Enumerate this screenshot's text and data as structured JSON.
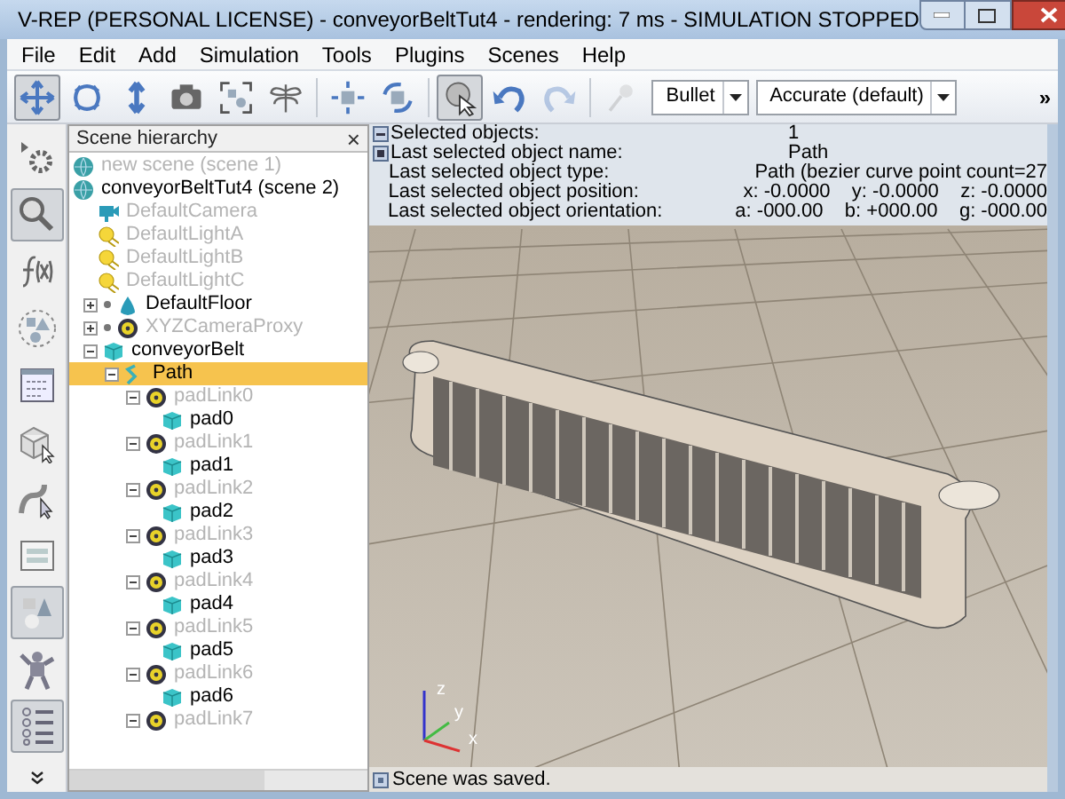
{
  "window": {
    "title": "V-REP (PERSONAL LICENSE) - conveyorBeltTut4 - rendering: 7 ms - SIMULATION STOPPED"
  },
  "menu": [
    "File",
    "Edit",
    "Add",
    "Simulation",
    "Tools",
    "Plugins",
    "Scenes",
    "Help"
  ],
  "toolbar": [
    {
      "kind": "move",
      "selected": true,
      "disabled": false
    },
    {
      "kind": "rotate",
      "selected": false,
      "disabled": false
    },
    {
      "kind": "zoom",
      "selected": false,
      "disabled": false
    },
    {
      "kind": "camera",
      "selected": false,
      "disabled": false
    },
    {
      "kind": "fit",
      "selected": false,
      "disabled": false
    },
    {
      "kind": "fly",
      "selected": false,
      "disabled": false
    },
    {
      "kind": "sep"
    },
    {
      "kind": "translate",
      "selected": false,
      "disabled": false
    },
    {
      "kind": "orient",
      "selected": false,
      "disabled": false
    },
    {
      "kind": "sep"
    },
    {
      "kind": "pointer",
      "selected": true,
      "disabled": false
    },
    {
      "kind": "undo",
      "selected": false,
      "disabled": false
    },
    {
      "kind": "redo",
      "selected": false,
      "disabled": true
    },
    {
      "kind": "sep"
    },
    {
      "kind": "pin",
      "selected": false,
      "disabled": true
    }
  ],
  "engine_dropdowns": [
    {
      "value": "Bullet"
    },
    {
      "value": "Accurate (default)"
    }
  ],
  "toolbar_overflow": "»",
  "side_toolbar": [
    {
      "kind": "properties",
      "selected": false
    },
    {
      "kind": "magnifier",
      "selected": true
    },
    {
      "kind": "script",
      "selected": false
    },
    {
      "kind": "shapes",
      "selected": false
    },
    {
      "kind": "dialog",
      "selected": false
    },
    {
      "kind": "cube",
      "selected": false
    },
    {
      "kind": "path",
      "selected": false
    },
    {
      "kind": "form",
      "selected": false
    },
    {
      "kind": "shapeedit",
      "selected": true
    },
    {
      "kind": "robot",
      "selected": false
    },
    {
      "kind": "list",
      "selected": true
    }
  ],
  "hierarchy": {
    "title": "Scene hierarchy",
    "close": "×",
    "items": [
      {
        "label": "new scene (scene 1)",
        "kind": "scene",
        "dimmed": true,
        "selected": false
      },
      {
        "label": "conveyorBeltTut4 (scene 2)",
        "kind": "scene",
        "dimmed": false,
        "selected": false,
        "children": [
          {
            "label": "DefaultCamera",
            "kind": "camera",
            "dimmed": true,
            "selected": false
          },
          {
            "label": "DefaultLightA",
            "kind": "light",
            "dimmed": true,
            "selected": false
          },
          {
            "label": "DefaultLightB",
            "kind": "light",
            "dimmed": true,
            "selected": false
          },
          {
            "label": "DefaultLightC",
            "kind": "light",
            "dimmed": true,
            "selected": false
          },
          {
            "label": "DefaultFloor",
            "kind": "floor",
            "dimmed": false,
            "selected": false,
            "expanded": false
          },
          {
            "label": "XYZCameraProxy",
            "kind": "dummy",
            "dimmed": true,
            "selected": false,
            "expanded": false
          },
          {
            "label": "conveyorBelt",
            "kind": "shape",
            "dimmed": false,
            "selected": false,
            "expanded": true,
            "children": [
              {
                "label": "Path",
                "kind": "path",
                "dimmed": false,
                "selected": true,
                "expanded": true,
                "children": [
                  {
                    "label": "padLink0",
                    "kind": "joint",
                    "dimmed": true,
                    "selected": false,
                    "expanded": true,
                    "children": [
                      {
                        "label": "pad0",
                        "kind": "shape",
                        "dimmed": false,
                        "selected": false
                      }
                    ]
                  },
                  {
                    "label": "padLink1",
                    "kind": "joint",
                    "dimmed": true,
                    "selected": false,
                    "expanded": true,
                    "children": [
                      {
                        "label": "pad1",
                        "kind": "shape",
                        "dimmed": false,
                        "selected": false
                      }
                    ]
                  },
                  {
                    "label": "padLink2",
                    "kind": "joint",
                    "dimmed": true,
                    "selected": false,
                    "expanded": true,
                    "children": [
                      {
                        "label": "pad2",
                        "kind": "shape",
                        "dimmed": false,
                        "selected": false
                      }
                    ]
                  },
                  {
                    "label": "padLink3",
                    "kind": "joint",
                    "dimmed": true,
                    "selected": false,
                    "expanded": true,
                    "children": [
                      {
                        "label": "pad3",
                        "kind": "shape",
                        "dimmed": false,
                        "selected": false
                      }
                    ]
                  },
                  {
                    "label": "padLink4",
                    "kind": "joint",
                    "dimmed": true,
                    "selected": false,
                    "expanded": true,
                    "children": [
                      {
                        "label": "pad4",
                        "kind": "shape",
                        "dimmed": false,
                        "selected": false
                      }
                    ]
                  },
                  {
                    "label": "padLink5",
                    "kind": "joint",
                    "dimmed": true,
                    "selected": false,
                    "expanded": true,
                    "children": [
                      {
                        "label": "pad5",
                        "kind": "shape",
                        "dimmed": false,
                        "selected": false
                      }
                    ]
                  },
                  {
                    "label": "padLink6",
                    "kind": "joint",
                    "dimmed": true,
                    "selected": false,
                    "expanded": true,
                    "children": [
                      {
                        "label": "pad6",
                        "kind": "shape",
                        "dimmed": false,
                        "selected": false
                      }
                    ]
                  },
                  {
                    "label": "padLink7",
                    "kind": "joint",
                    "dimmed": true,
                    "selected": false,
                    "expanded": true
                  }
                ]
              }
            ]
          }
        ]
      }
    ]
  },
  "info": [
    {
      "label": "Selected objects:",
      "value": "1"
    },
    {
      "label": "Last selected object name:",
      "value": "Path"
    },
    {
      "label": "Last selected object type:",
      "value": "Path (bezier curve point count=27"
    },
    {
      "label": "Last selected object position:",
      "value": "x: -0.0000    y: -0.0000    z: -0.0000"
    },
    {
      "label": "Last selected object orientation:",
      "value": "a: -000.00    b: +000.00    g: -000.00"
    }
  ],
  "axes": {
    "z": "z",
    "y": "y",
    "x": "x"
  },
  "status_bar": "Scene was saved."
}
